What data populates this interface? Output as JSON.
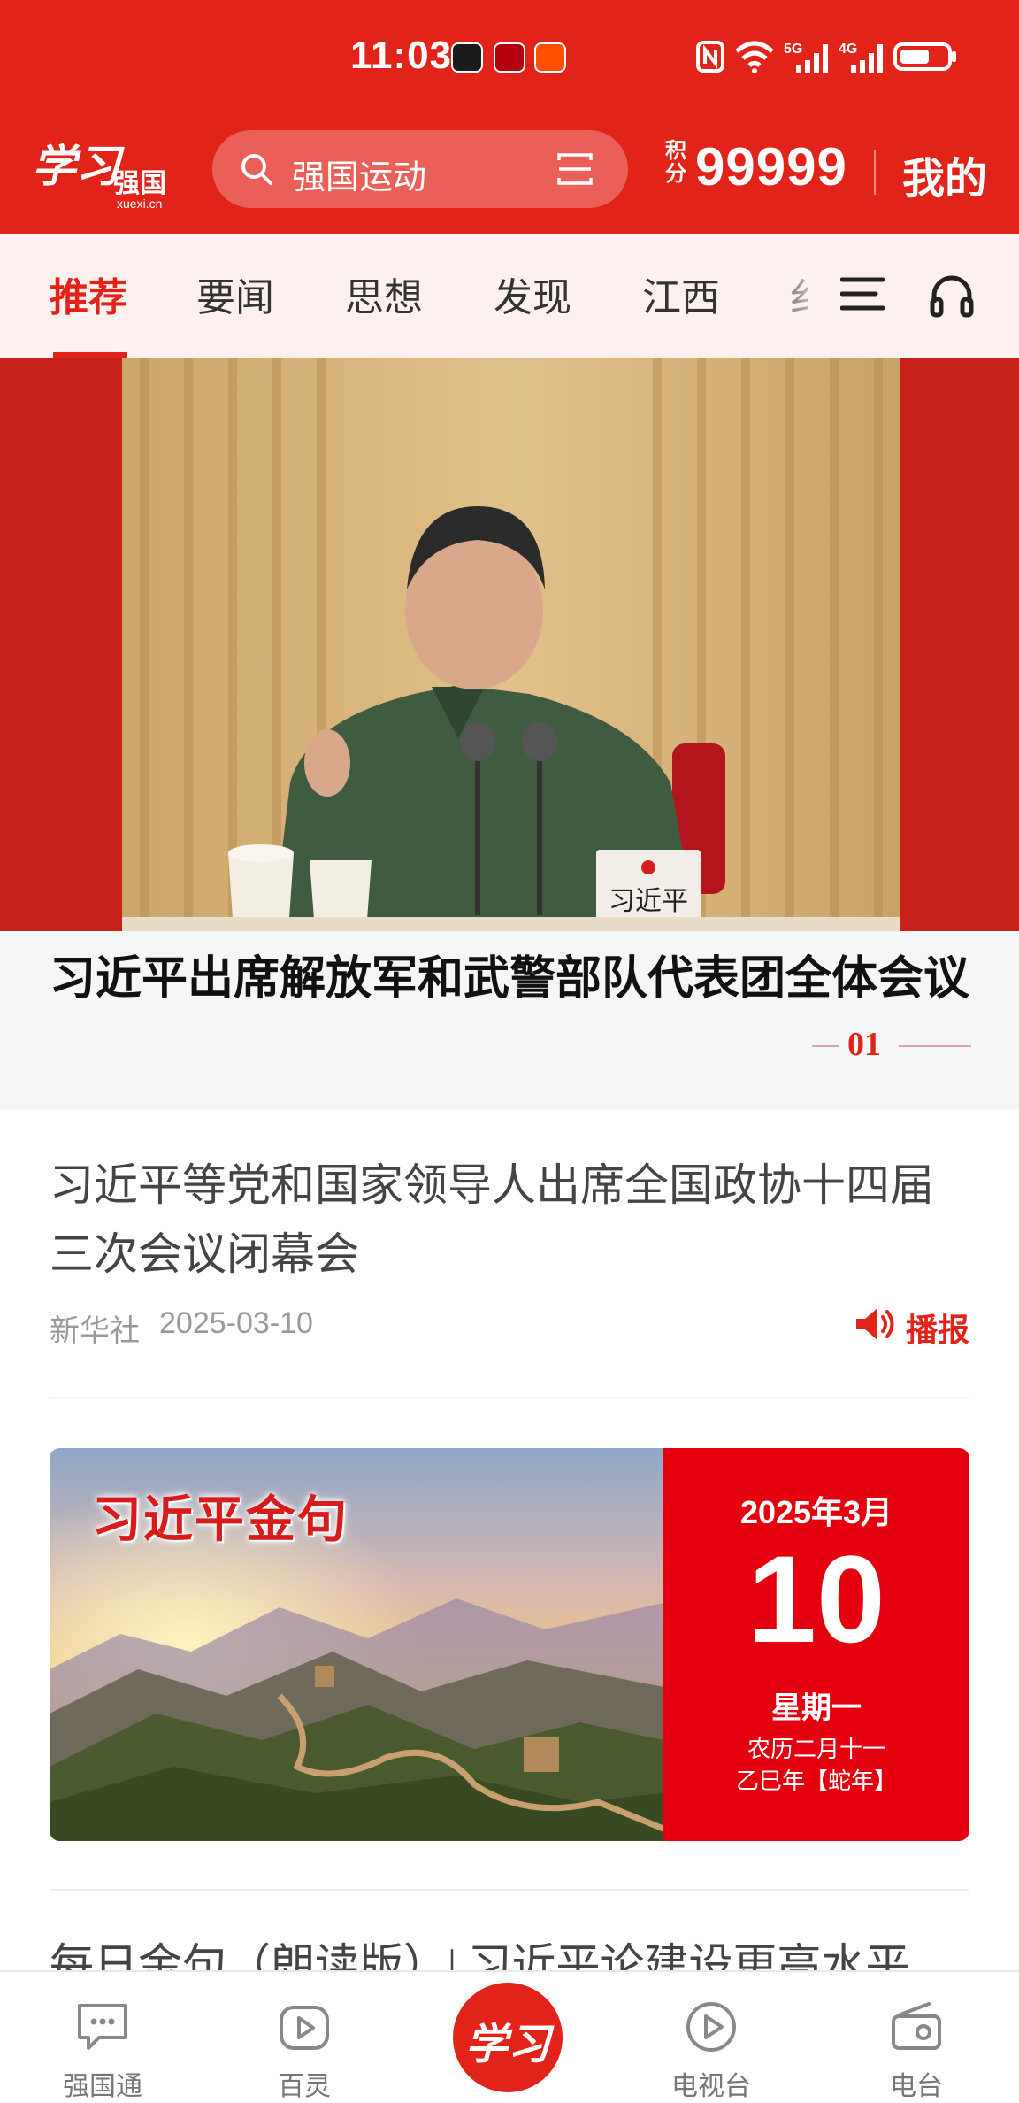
{
  "status_bar": {
    "time": "11:03",
    "notification_icons": [
      "tmall-icon",
      "pinduoduo-icon",
      "taobao-icon"
    ],
    "indicators": [
      "nfc-icon",
      "wifi-icon",
      "5g-signal-icon",
      "4g-signal-icon",
      "battery-icon"
    ],
    "network_1": "5G",
    "network_2": "4G"
  },
  "header": {
    "logo_script": "学习",
    "logo_name": "强国",
    "logo_domain": "xuexi.cn",
    "search_placeholder": "强国运动",
    "points_label": "积分",
    "points_value": "99999",
    "mine_label": "我的"
  },
  "tabs": {
    "items": [
      "推荐",
      "要闻",
      "思想",
      "发现",
      "江西",
      "纟"
    ],
    "active": "推荐"
  },
  "hero": {
    "title": "习近平出席解放军和武警部队代表团全体会议",
    "index": "01",
    "nameplate": "习近平"
  },
  "article": {
    "title": "习近平等党和国家领导人出席全国政协十四届三次会议闭幕会",
    "source": "新华社",
    "date": "2025-03-10",
    "action_label": "播报"
  },
  "banner": {
    "title": "习近平金句",
    "year_month": "2025年3月",
    "day": "10",
    "weekday": "星期一",
    "lunar_line1": "农历二月十一",
    "lunar_line2": "乙巳年【蛇年】"
  },
  "next_article": {
    "title": "每日金句（朗读版）| 习近平论建设更高水平"
  },
  "bottom_nav": {
    "items": [
      {
        "label": "强国通",
        "icon": "chat-icon"
      },
      {
        "label": "百灵",
        "icon": "video-play-icon"
      },
      {
        "label": "学习",
        "icon": "xuexi-logo"
      },
      {
        "label": "电视台",
        "icon": "tv-play-icon"
      },
      {
        "label": "电台",
        "icon": "radio-icon"
      }
    ]
  },
  "colors": {
    "brand_red": "#e2231a",
    "tab_background": "#fdf1ef",
    "calendar_red": "#e4000f"
  }
}
